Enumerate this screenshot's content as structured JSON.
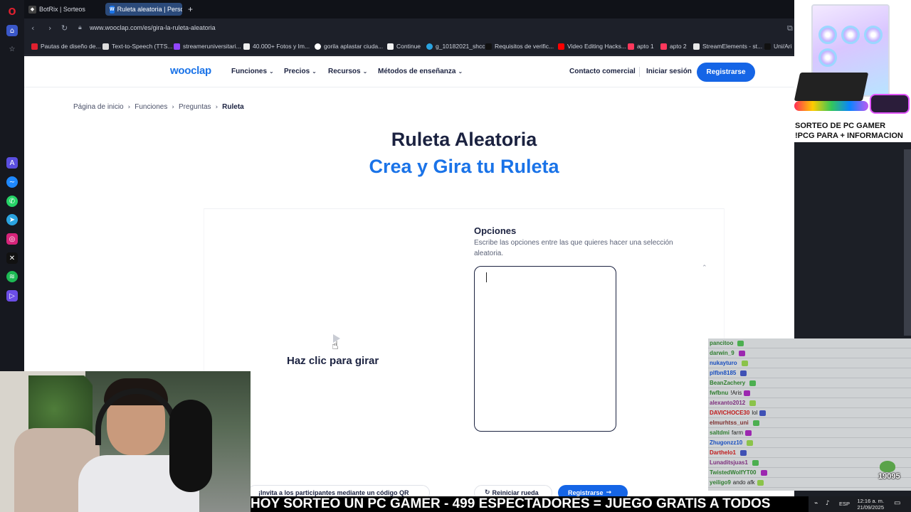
{
  "browser": {
    "tabs": [
      {
        "title": "BotRix | Sorteos",
        "active": false
      },
      {
        "title": "Ruleta aleatoria | Personal",
        "active": true
      }
    ],
    "new_tab_icon": "+",
    "url": "www.wooclap.com/es/gira-la-ruleta-aleatoria",
    "bookmarks": [
      "Pautas de diseño de...",
      "Text-to-Speech (TTS...",
      "streameruniversitari...",
      "40.000+ Fotos y Im...",
      "gorila aplastar ciuda...",
      "Continue",
      "g_10182021_shcc",
      "Requisitos de verific...",
      "Video Editing Hacks...",
      "apto 1",
      "apto 2",
      "StreamElements - st...",
      "Uni/Ari"
    ]
  },
  "site": {
    "logo": "wooclap",
    "nav": [
      "Funciones",
      "Precios",
      "Recursos",
      "Métodos de enseñanza"
    ],
    "contact": "Contacto comercial",
    "login": "Iniciar sesión",
    "register": "Registrarse",
    "breadcrumb": [
      "Página de inicio",
      "Funciones",
      "Preguntas",
      "Ruleta"
    ],
    "title": "Ruleta Aleatoria",
    "subtitle": "Crea y Gira tu Ruleta",
    "spin_label": "Haz clic para girar",
    "options_title": "Opciones",
    "options_desc": "Escribe las opciones entre las que quieres hacer una selección aleatoria.",
    "options_value": "",
    "bottom_hint": "¡Invita a los participantes mediante un código QR",
    "reset_label": "Reiniciar rueda",
    "register_bottom": "Registrarse"
  },
  "overlay": {
    "promo_line1": "SORTEO DE PC GAMER",
    "promo_line2": "!PCG PARA + INFORMACION",
    "ticker": "HOY SORTEO UN PC GAMER - 499 ESPECTADORES = JUEGO GRATIS A TODOS",
    "viewer_counter": "19095",
    "chat": [
      {
        "user": "pancitoo",
        "msg": "",
        "color": "#2f7d2f"
      },
      {
        "user": "darwin_9",
        "msg": "",
        "color": "#2f7d2f"
      },
      {
        "user": "nukayturo",
        "msg": "",
        "color": "#1a4fbf"
      },
      {
        "user": "plfbn8185",
        "msg": "",
        "color": "#1a4fbf"
      },
      {
        "user": "BeanZachery",
        "msg": "",
        "color": "#2f7d2f"
      },
      {
        "user": "fwfbnu",
        "msg": "!Aris",
        "color": "#2f7d2f"
      },
      {
        "user": "alexanto2012",
        "msg": "",
        "color": "#7d2f7d"
      },
      {
        "user": "DAVICHOCE30",
        "msg": "lol",
        "color": "#bf1a1a"
      },
      {
        "user": "elmurhtss_uni",
        "msg": "",
        "color": "#7d2f2f"
      },
      {
        "user": "saltdmi",
        "msg": "farm",
        "color": "#2f7d2f"
      },
      {
        "user": "Zhugonzz10",
        "msg": "",
        "color": "#1a4fbf"
      },
      {
        "user": "Darthelo1",
        "msg": "",
        "color": "#bf1a1a"
      },
      {
        "user": "Lunaditsjuas1",
        "msg": "",
        "color": "#7d2f7d"
      },
      {
        "user": "TwistedWolfYT00",
        "msg": "",
        "color": "#2f7d2f"
      },
      {
        "user": "yeiligo9",
        "msg": "ando afk",
        "color": "#2f7d2f"
      }
    ]
  },
  "tray": {
    "lang": "ESP",
    "time": "12:16 a. m.",
    "date": "21/09/2025"
  },
  "colors": {
    "brand_blue": "#1565e6",
    "heading_navy": "#1b2240",
    "sidebar_bg": "#16181f"
  },
  "icons": [
    "opera-logo-icon",
    "home-icon",
    "star-icon",
    "aria-icon",
    "messenger-icon",
    "whatsapp-icon",
    "telegram-icon",
    "instagram-icon",
    "x-icon",
    "spotify-icon",
    "player-icon"
  ]
}
